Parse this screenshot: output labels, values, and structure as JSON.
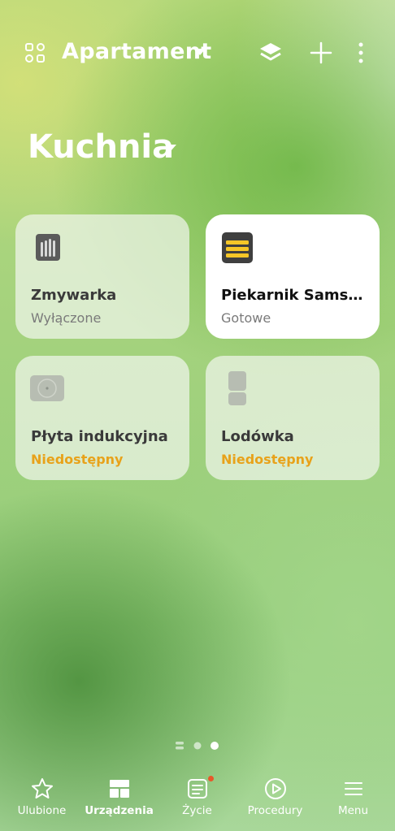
{
  "header": {
    "home_name": "Apartament",
    "icons": [
      "home-grid-icon",
      "chevron-down-icon",
      "layers-icon",
      "plus-icon",
      "more-vertical-icon"
    ]
  },
  "room": {
    "name": "Kuchnia"
  },
  "devices": [
    {
      "name": "Zmywarka",
      "status": "Wyłączone",
      "icon": "dishwasher-icon",
      "state": "off"
    },
    {
      "name": "Piekarnik Samsu…",
      "status": "Gotowe",
      "icon": "oven-icon",
      "state": "ready"
    },
    {
      "name": "Płyta indukcyjna",
      "status": "Niedostępny",
      "icon": "cooktop-icon",
      "state": "unavailable"
    },
    {
      "name": "Lodówka",
      "status": "Niedostępny",
      "icon": "fridge-icon",
      "state": "unavailable"
    }
  ],
  "pager": {
    "total": 3,
    "current": 3
  },
  "tabs": [
    {
      "label": "Ulubione",
      "icon": "star-icon"
    },
    {
      "label": "Urządzenia",
      "icon": "devices-icon",
      "active": true
    },
    {
      "label": "Życie",
      "icon": "life-icon",
      "badge": true
    },
    {
      "label": "Procedury",
      "icon": "play-circle-icon"
    },
    {
      "label": "Menu",
      "icon": "menu-icon"
    }
  ],
  "colors": {
    "warning": "#e8a21a",
    "badge": "#e8572a",
    "oven_accent": "#f6c627"
  }
}
